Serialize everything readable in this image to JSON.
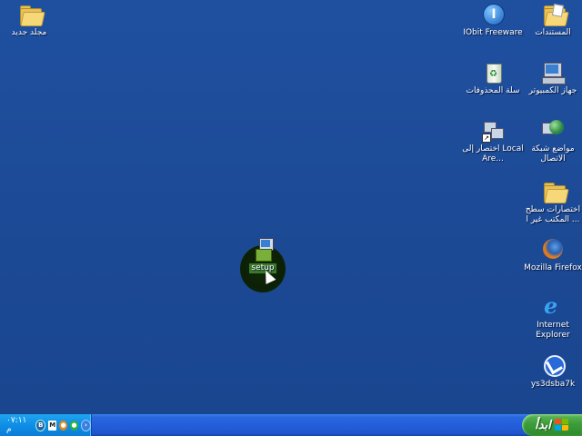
{
  "desktop": {
    "icons": {
      "my_documents": "المستندات",
      "iobit": "IObit Freeware",
      "my_computer": "جهاز الكمبيوتر",
      "recycle_bin": "سلة المحذوفات",
      "network_places": "مواضع شبكة الاتصال",
      "lan_shortcut": "اختصار إلى Local Are...",
      "desktop_shortcuts": "اختصارات سطح المكتب غير ا ...",
      "firefox": "Mozilla Firefox",
      "ie": "Internet Explorer",
      "ys3dsba7k": "ys3dsba7k",
      "new_folder": "مجلد جديد",
      "setup": "setup"
    }
  },
  "taskbar": {
    "start_label": "ابدأ",
    "clock": "٠٧:١١ م",
    "colors": {
      "taskbar": "#245edb",
      "start": "#3c9c3a",
      "tray": "#0f8ee6",
      "desktop": "#1e4e96"
    }
  }
}
